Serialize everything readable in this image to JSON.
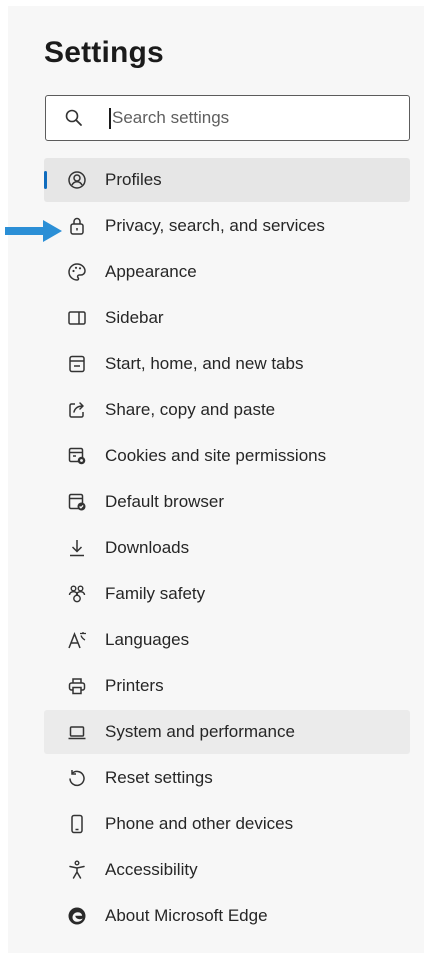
{
  "header": {
    "title": "Settings"
  },
  "search": {
    "placeholder": "Search settings",
    "icon": "search-icon"
  },
  "nav": {
    "items": [
      {
        "label": "Profiles",
        "icon": "profile-icon",
        "state": "selected"
      },
      {
        "label": "Privacy, search, and services",
        "icon": "lock-icon",
        "state": "normal"
      },
      {
        "label": "Appearance",
        "icon": "palette-icon",
        "state": "normal"
      },
      {
        "label": "Sidebar",
        "icon": "sidebar-icon",
        "state": "normal"
      },
      {
        "label": "Start, home, and new tabs",
        "icon": "home-tabs-icon",
        "state": "normal"
      },
      {
        "label": "Share, copy and paste",
        "icon": "share-icon",
        "state": "normal"
      },
      {
        "label": "Cookies and site permissions",
        "icon": "cookies-permissions-icon",
        "state": "normal"
      },
      {
        "label": "Default browser",
        "icon": "default-browser-icon",
        "state": "normal"
      },
      {
        "label": "Downloads",
        "icon": "download-icon",
        "state": "normal"
      },
      {
        "label": "Family safety",
        "icon": "family-icon",
        "state": "normal"
      },
      {
        "label": "Languages",
        "icon": "languages-icon",
        "state": "normal"
      },
      {
        "label": "Printers",
        "icon": "printer-icon",
        "state": "normal"
      },
      {
        "label": "System and performance",
        "icon": "laptop-icon",
        "state": "hovered"
      },
      {
        "label": "Reset settings",
        "icon": "reset-icon",
        "state": "normal"
      },
      {
        "label": "Phone and other devices",
        "icon": "phone-icon",
        "state": "normal"
      },
      {
        "label": "Accessibility",
        "icon": "accessibility-icon",
        "state": "normal"
      },
      {
        "label": "About Microsoft Edge",
        "icon": "edge-logo-icon",
        "state": "normal"
      }
    ]
  },
  "annotation": {
    "pointer": "arrow-right-icon",
    "target_item": "Privacy, search, and services",
    "color": "#2b8fd6"
  },
  "colors": {
    "accent": "#0f6cbd",
    "panel_background": "#f7f7f7",
    "selected_background": "#e6e6e6",
    "text": "#262626"
  }
}
